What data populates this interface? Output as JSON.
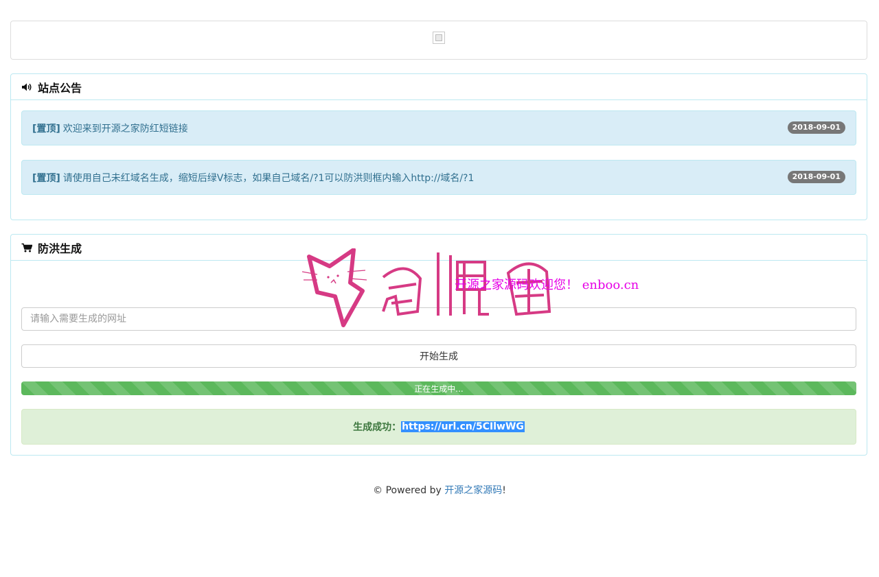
{
  "notice_panel": {
    "title": "站点公告",
    "icon": "speaker-icon",
    "items": [
      {
        "tag": "[置顶]",
        "text": "欢迎来到开源之家防红短链接",
        "date": "2018-09-01"
      },
      {
        "tag": "[置顶]",
        "text": "请使用自己未红域名生成，缩短后绿V标志，如果自己域名/?1可以防洪则框内输入http://域名/?1",
        "date": "2018-09-01"
      }
    ]
  },
  "generator_panel": {
    "title": "防洪生成",
    "icon": "cart-icon",
    "url_input": {
      "placeholder": "请输入需要生成的网址",
      "value": ""
    },
    "generate_button": "开始生成",
    "progress": {
      "label": "正在生成中...",
      "percent": 100
    },
    "result": {
      "label": "生成成功：",
      "url": "https://url.cn/5CIlwWG"
    }
  },
  "watermark": {
    "logo_text": "奇偶猫",
    "text": "开源之家源码欢迎您！ enboo.cn"
  },
  "footer": {
    "prefix": "© Powered by ",
    "link": "开源之家源码",
    "suffix": "!"
  },
  "colors": {
    "info_bg": "#d9edf7",
    "info_text": "#31708f",
    "success_bg": "#dff0d8",
    "success_text": "#3c763d",
    "progress": "#5cb85c",
    "badge": "#777777",
    "watermark_pink": "#d63a84",
    "watermark_magenta": "#e600e6"
  }
}
